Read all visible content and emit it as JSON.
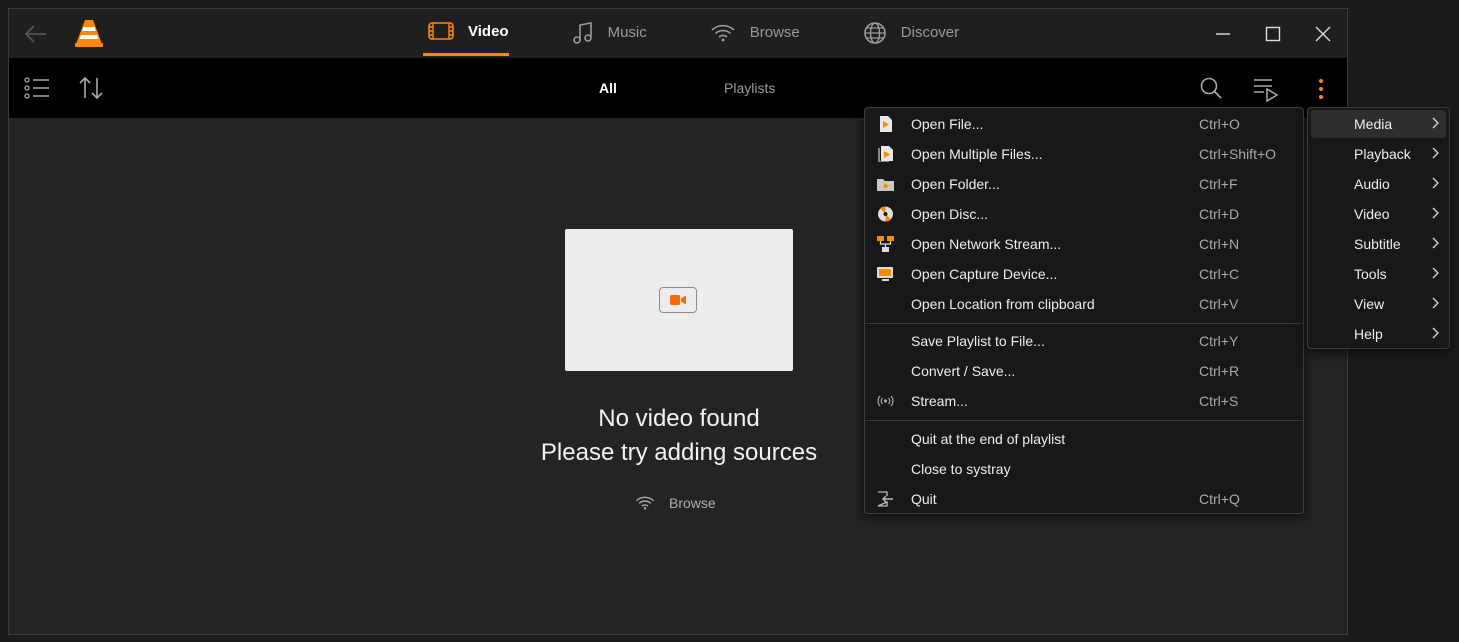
{
  "colors": {
    "accent": "#ff8800",
    "background": "#242424",
    "menu_bg": "#181818"
  },
  "header": {
    "tabs": [
      {
        "label": "Video",
        "icon": "film-icon",
        "active": true
      },
      {
        "label": "Music",
        "icon": "music-note-icon",
        "active": false
      },
      {
        "label": "Browse",
        "icon": "wifi-icon",
        "active": false
      },
      {
        "label": "Discover",
        "icon": "globe-icon",
        "active": false
      }
    ]
  },
  "toolbar": {
    "subtabs": [
      {
        "label": "All",
        "active": true
      },
      {
        "label": "Playlists",
        "active": false
      }
    ]
  },
  "empty_state": {
    "line1": "No video found",
    "line2": "Please try adding sources",
    "browse_label": "Browse"
  },
  "menu": {
    "items": [
      {
        "label": "Open File...",
        "shortcut": "Ctrl+O",
        "icon": "file-play-icon"
      },
      {
        "label": "Open Multiple Files...",
        "shortcut": "Ctrl+Shift+O",
        "icon": "files-play-icon"
      },
      {
        "label": "Open Folder...",
        "shortcut": "Ctrl+F",
        "icon": "folder-icon"
      },
      {
        "label": "Open Disc...",
        "shortcut": "Ctrl+D",
        "icon": "disc-icon"
      },
      {
        "label": "Open Network Stream...",
        "shortcut": "Ctrl+N",
        "icon": "network-icon"
      },
      {
        "label": "Open Capture Device...",
        "shortcut": "Ctrl+C",
        "icon": "capture-device-icon"
      },
      {
        "label": "Open Location from clipboard",
        "shortcut": "Ctrl+V",
        "icon": ""
      },
      {
        "label": "Save Playlist to File...",
        "shortcut": "Ctrl+Y",
        "icon": ""
      },
      {
        "label": "Convert / Save...",
        "shortcut": "Ctrl+R",
        "icon": ""
      },
      {
        "label": "Stream...",
        "shortcut": "Ctrl+S",
        "icon": "broadcast-icon"
      },
      {
        "label": "Quit at the end of playlist",
        "shortcut": "",
        "icon": ""
      },
      {
        "label": "Close to systray",
        "shortcut": "",
        "icon": ""
      },
      {
        "label": "Quit",
        "shortcut": "Ctrl+Q",
        "icon": "exit-icon"
      }
    ]
  },
  "submenu": {
    "items": [
      {
        "label": "Media",
        "active": true
      },
      {
        "label": "Playback",
        "active": false
      },
      {
        "label": "Audio",
        "active": false
      },
      {
        "label": "Video",
        "active": false
      },
      {
        "label": "Subtitle",
        "active": false
      },
      {
        "label": "Tools",
        "active": false
      },
      {
        "label": "View",
        "active": false
      },
      {
        "label": "Help",
        "active": false
      }
    ]
  }
}
